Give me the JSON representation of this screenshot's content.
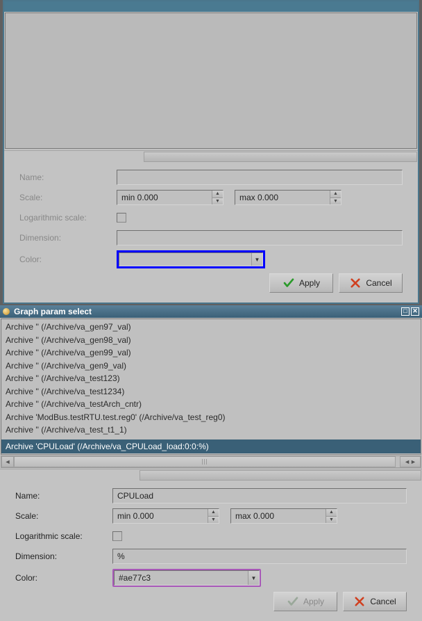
{
  "top": {
    "fields": {
      "name_label": "Name:",
      "name_value": "",
      "scale_label": "Scale:",
      "scale_min": "min 0.000",
      "scale_max": "max 0.000",
      "log_label": "Logarithmic scale:",
      "log_checked": false,
      "dimension_label": "Dimension:",
      "dimension_value": "",
      "color_label": "Color:",
      "color_value": ""
    },
    "buttons": {
      "apply": "Apply",
      "cancel": "Cancel"
    }
  },
  "bottom": {
    "title": "Graph param select",
    "list": [
      "Archive '' (/Archive/va_gen97_val)",
      "Archive '' (/Archive/va_gen98_val)",
      "Archive '' (/Archive/va_gen99_val)",
      "Archive '' (/Archive/va_gen9_val)",
      "Archive '' (/Archive/va_test123)",
      "Archive '' (/Archive/va_test1234)",
      "Archive '' (/Archive/va_testArch_cntr)",
      "Archive 'ModBus.testRTU.test.reg0' (/Archive/va_test_reg0)",
      "Archive '' (/Archive/va_test_t1_1)"
    ],
    "selected": "Archive 'CPULoad' (/Archive/va_CPULoad_load:0:0:%)",
    "fields": {
      "name_label": "Name:",
      "name_value": "CPULoad",
      "scale_label": "Scale:",
      "scale_min": "min 0.000",
      "scale_max": "max 0.000",
      "log_label": "Logarithmic scale:",
      "log_checked": false,
      "dimension_label": "Dimension:",
      "dimension_value": "%",
      "color_label": "Color:",
      "color_value": "#ae77c3"
    },
    "buttons": {
      "apply": "Apply",
      "cancel": "Cancel"
    }
  }
}
